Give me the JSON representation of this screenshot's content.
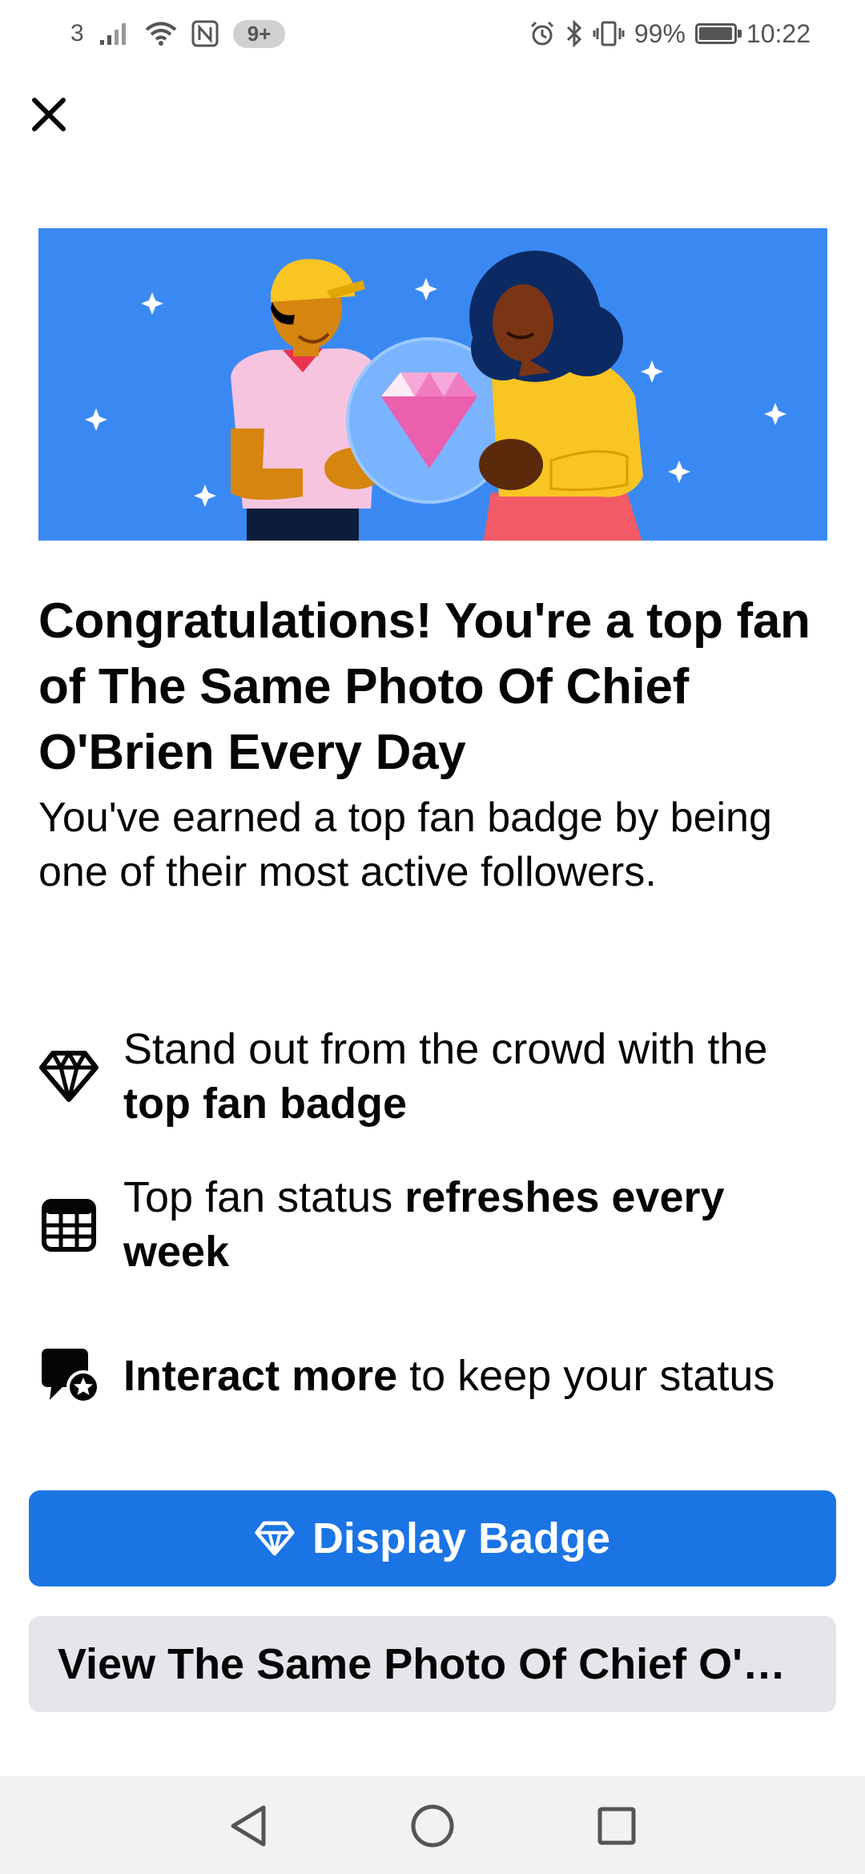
{
  "status_bar": {
    "carrier": "3",
    "notification_count": "9+",
    "battery_percent": "99%",
    "battery_level": 0.99,
    "time": "10:22"
  },
  "close_icon": "close-icon",
  "hero": {
    "colors": {
      "background": "#3a89f3",
      "circle": "#7ab4ff",
      "gem": "#f07cc0"
    }
  },
  "headline": "Congratulations! You're a top fan of The Same Photo Of Chief O'Brien Every Day",
  "subtext": "You've earned a top fan badge by being one of their most active followers.",
  "features": [
    {
      "icon": "diamond-icon",
      "text_before": "Stand out from the crowd with the ",
      "text_bold": "top fan badge",
      "text_after": ""
    },
    {
      "icon": "calendar-icon",
      "text_before": "Top fan status ",
      "text_bold": "refreshes every week",
      "text_after": ""
    },
    {
      "icon": "chat-star-icon",
      "text_before": "",
      "text_bold": "Interact more",
      "text_after": " to keep your status"
    }
  ],
  "buttons": {
    "primary_label": "Display Badge",
    "primary_icon": "diamond-icon",
    "secondary_label": "View The Same Photo Of Chief O'Brien Every Day"
  },
  "colors": {
    "accent": "#1b74e4",
    "secondary_bg": "#e4e6eb",
    "text": "#050505"
  },
  "nav_bar": {
    "back": "back-triangle-icon",
    "home": "home-circle-icon",
    "recents": "recents-square-icon"
  }
}
